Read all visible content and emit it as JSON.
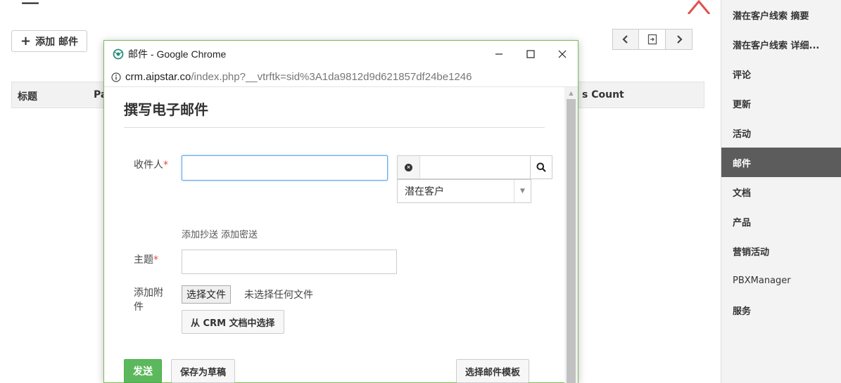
{
  "caption": {
    "text": "一"
  },
  "toolbar": {
    "add_email_label": "添加 邮件"
  },
  "list": {
    "columns": [
      "标题",
      "Pa",
      "s Count"
    ]
  },
  "sidebar": {
    "items": [
      {
        "label": "潜在客户线索 摘要",
        "active": false
      },
      {
        "label": "潜在客户线索 详细...",
        "active": false
      },
      {
        "label": "评论",
        "active": false
      },
      {
        "label": "更新",
        "active": false
      },
      {
        "label": "活动",
        "active": false
      },
      {
        "label": "邮件",
        "active": true
      },
      {
        "label": "文档",
        "active": false
      },
      {
        "label": "产品",
        "active": false
      },
      {
        "label": "营销活动",
        "active": false
      },
      {
        "label": "PBXManager",
        "active": false
      },
      {
        "label": "服务",
        "active": false
      }
    ]
  },
  "popup": {
    "window_title": "邮件 - Google Chrome",
    "url_host": "crm.aipstar.co",
    "url_path": "/index.php?__vtrftk=sid%3A1da9812d9d621857df24be1246",
    "border_color": "#7fb85a"
  },
  "compose": {
    "title": "撰写电子邮件",
    "to_label": "收件人",
    "required_mark": "*",
    "to_value": "",
    "module_select": "潜在客户",
    "add_cc": "添加抄送",
    "add_bcc": "添加密送",
    "subject_label": "主题",
    "subject_value": "",
    "attach_label": "添加附件",
    "choose_file": "选择文件",
    "no_file": "未选择任何文件",
    "crm_doc_btn": "从 CRM 文档中选择",
    "send_btn": "发送",
    "draft_btn": "保存为草稿",
    "template_btn": "选择邮件模板",
    "send_color": "#5cb85c"
  }
}
